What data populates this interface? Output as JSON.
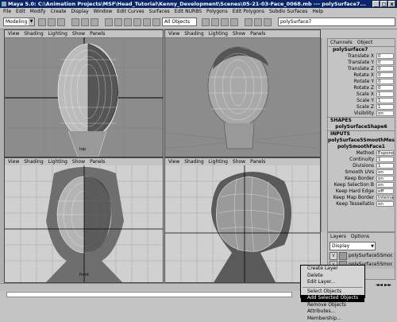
{
  "window": {
    "title": "Maya 5.0: C:\\Animation Projects\\MSF\\Head_Tutorial\\Kenny_Development\\Scenes\\05-21-03-Face_0068.mb  ---  polySurface7...",
    "controls": [
      "_",
      "□",
      "x"
    ]
  },
  "menubar": [
    "File",
    "Edit",
    "Modify",
    "Create",
    "Display",
    "Window",
    "Edit Curves",
    "Surfaces",
    "Edit NURBS",
    "Polygons",
    "Edit Polygons",
    "Subdiv Surfaces",
    "Help"
  ],
  "status_line": {
    "mode": "Modeling",
    "selection_mask": "All Objects",
    "object_name": "polySurface7"
  },
  "viewports": [
    {
      "menu": [
        "View",
        "Shading",
        "Lighting",
        "Show",
        "Panels"
      ],
      "camera": "top"
    },
    {
      "menu": [
        "View",
        "Shading",
        "Lighting",
        "Show",
        "Panels"
      ],
      "camera": ""
    },
    {
      "menu": [
        "View",
        "Shading",
        "Lighting",
        "Show",
        "Panels"
      ],
      "camera": "front"
    },
    {
      "menu": [
        "View",
        "Shading",
        "Lighting",
        "Show",
        "Panels"
      ],
      "camera": ""
    }
  ],
  "channel_box": {
    "menu": [
      "Channels",
      "Object"
    ],
    "object": "polySurface7",
    "attributes": [
      {
        "label": "Translate X",
        "value": "0"
      },
      {
        "label": "Translate Y",
        "value": "0"
      },
      {
        "label": "Translate Z",
        "value": "0"
      },
      {
        "label": "Rotate X",
        "value": "0"
      },
      {
        "label": "Rotate Y",
        "value": "0"
      },
      {
        "label": "Rotate Z",
        "value": "0"
      },
      {
        "label": "Scale X",
        "value": "1"
      },
      {
        "label": "Scale Y",
        "value": "1"
      },
      {
        "label": "Scale Z",
        "value": "1"
      },
      {
        "label": "Visibility",
        "value": "on"
      }
    ],
    "shapes_header": "SHAPES",
    "shape_node": "polySurfaceShape6",
    "inputs_header": "INPUTS",
    "input_nodes": [
      "polySurface5SmoothMes",
      "polySmoothFace1"
    ],
    "input_attributes": [
      {
        "label": "Method",
        "value": "Exponential"
      },
      {
        "label": "Continuity",
        "value": "1"
      },
      {
        "label": "Divisions",
        "value": "1"
      },
      {
        "label": "Smooth UVs",
        "value": "on"
      },
      {
        "label": "Keep Border",
        "value": "on"
      },
      {
        "label": "Keep Selection B",
        "value": "on"
      },
      {
        "label": "Keep Hard Edge",
        "value": "off"
      },
      {
        "label": "Keep Map Border",
        "value": "Internal"
      },
      {
        "label": "Keep Tessellatio",
        "value": "on"
      }
    ]
  },
  "layers": {
    "menu": [
      "Layers",
      "Options"
    ],
    "display": "Display",
    "rows": [
      {
        "vis": "V",
        "name": "polySurface5Smoot"
      },
      {
        "vis": "V",
        "name": "polySurface5Smoot"
      }
    ]
  },
  "context_menu": {
    "items": [
      "Create Layer",
      "Delete",
      "Edit Layer...",
      "Select Objects",
      "Add Selected Objects",
      "Remove Objects",
      "Attributes...",
      "Membership..."
    ],
    "highlighted_index": 4
  },
  "colors": {
    "title_bar": "#0a246a",
    "ui_gray": "#c4c4c4",
    "viewport_bg": "#8c8c8c"
  }
}
